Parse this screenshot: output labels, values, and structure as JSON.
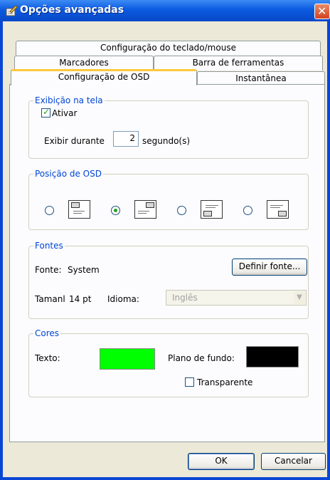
{
  "window": {
    "title": "Opções avançadas",
    "close_glyph": "✕"
  },
  "tabs": {
    "row1": [
      "Configuração do teclado/mouse"
    ],
    "row2": [
      "Marcadores",
      "Barra de ferramentas"
    ],
    "row3": [
      "Configuração de OSD",
      "Instantânea"
    ],
    "active": "Configuração de OSD"
  },
  "osd_display": {
    "legend": "Exibição na tela",
    "enable_label": "Ativar",
    "enable_checked": true,
    "show_for_label": "Exibir durante",
    "show_for_value": "2",
    "unit_label": "segundo(s)"
  },
  "osd_position": {
    "legend": "Posição de OSD",
    "options": [
      "top-left",
      "top-right",
      "bottom-left",
      "bottom-right"
    ],
    "selected": "top-right"
  },
  "fonts": {
    "legend": "Fontes",
    "font_label": "Fonte:",
    "font_value": "System",
    "define_button": "Definir fonte...",
    "size_label": "Tamanl",
    "size_value": "14 pt",
    "language_label": "Idioma:",
    "language_value": "Inglês",
    "language_enabled": false
  },
  "colors": {
    "legend": "Cores",
    "text_label": "Texto:",
    "text_color": "#00ff00",
    "background_label": "Plano de fundo:",
    "background_color": "#000000",
    "transparent_label": "Transparente",
    "transparent_checked": false
  },
  "footer": {
    "ok_label": "OK",
    "cancel_label": "Cancelar"
  },
  "icons": {
    "title": "pencil-paper-icon",
    "dropdown": "chevron-down-icon"
  },
  "theme": {
    "titlebar": "#0b5ae0",
    "legend_color": "#0046d5",
    "active_tab_highlight": "#ffc83c",
    "check_color": "#21a121"
  }
}
